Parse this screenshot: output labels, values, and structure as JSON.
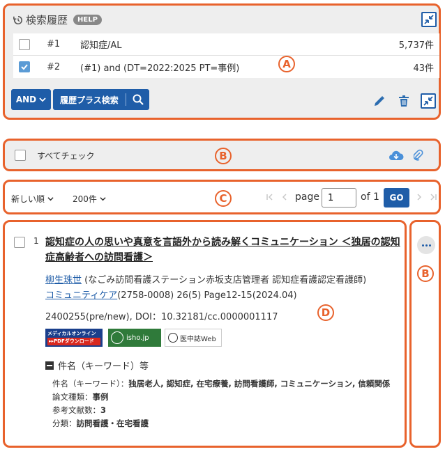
{
  "history": {
    "title": "検索履歴",
    "help": "HELP",
    "rows": [
      {
        "num": "#1",
        "query": "認知症/AL",
        "count": "5,737件",
        "checked": false
      },
      {
        "num": "#2",
        "query": "(#1) and (DT=2022:2025 PT=事例)",
        "count": "43件",
        "checked": true
      }
    ],
    "and_label": "AND",
    "plus_search_label": "履歴プラス検索"
  },
  "check_all": {
    "label": "すべてチェック"
  },
  "pager": {
    "sort_label": "新しい順",
    "per_page_label": "200件",
    "page_word": "page",
    "page_value": "1",
    "of_label": "of 1",
    "go_label": "GO"
  },
  "article": {
    "index": "1",
    "title": "認知症の人の思いや真意を言語外から読み解くコミュニケーション ＜独居の認知症高齢者への訪問看護＞",
    "author_link": "柳生珠世",
    "author_affil": " (なごみ訪問看護ステーション赤坂支店管理者 認知症看護認定看護師)",
    "journal_link": "コミュニティケア",
    "journal_info": "(2758-0008) 26(5) Page12-15(2024.04)",
    "ids": "2400255(pre/new), DOI：10.32181/cc.0000001117",
    "logos": {
      "medical_online_line1": "メディカルオンライン",
      "medical_online_line2": "▸▸PDFダウンロード",
      "isho": "isho.jp",
      "ichushi": "医中誌Web"
    },
    "keyword_section_label": "件名（キーワード）等",
    "keywords_label": "件名（キーワード）：",
    "keywords": "独居老人, 認知症, 在宅療養, 訪問看護師, コミュニケーション, 信頼関係",
    "type_label": "論文種類：",
    "type_value": "事例",
    "refs_label": "参考文献数：",
    "refs_value": "3",
    "class_label": "分類：",
    "class_value": "訪問看護・在宅看護"
  },
  "markers": {
    "a": "A",
    "b": "B",
    "c": "C",
    "d": "D"
  },
  "colors": {
    "frame": "#e8622c",
    "primary": "#1f5da8",
    "accent": "#5b9bd5",
    "panel_bg": "#eeeeee"
  }
}
